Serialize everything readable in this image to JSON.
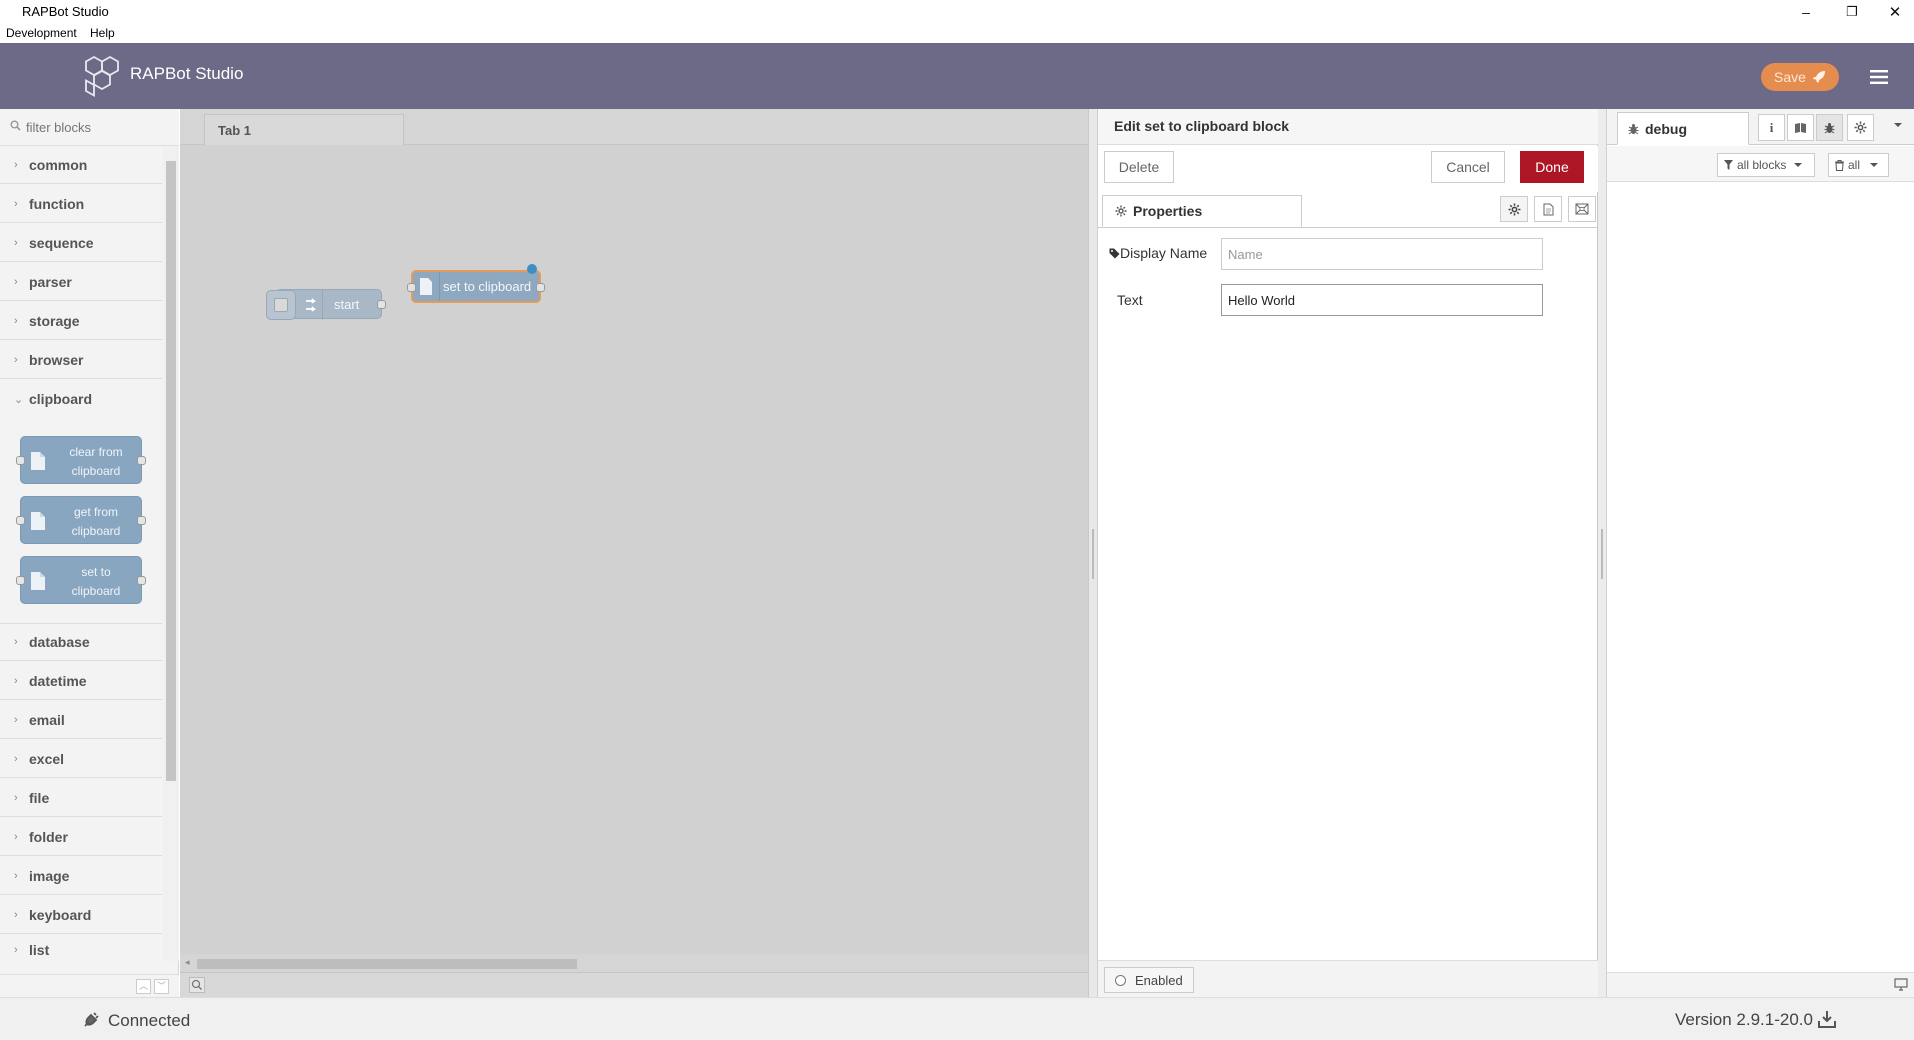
{
  "window": {
    "title": "RAPBot Studio",
    "controls": {
      "minimize": "–",
      "restore": "❐",
      "close": "✕"
    }
  },
  "menu": [
    "Development",
    "Help"
  ],
  "header": {
    "app_name": "RAPBot Studio",
    "save_label": "Save",
    "colors": {
      "header_bg": "#6d6a87",
      "save_bg": "#e58c4f"
    }
  },
  "palette": {
    "filter_placeholder": "filter blocks",
    "categories_top": [
      "common",
      "function",
      "sequence",
      "parser",
      "storage",
      "browser"
    ],
    "expanded_category": "clipboard",
    "clipboard_nodes": [
      {
        "line1": "clear from",
        "line2": "clipboard"
      },
      {
        "line1": "get from",
        "line2": "clipboard"
      },
      {
        "line1": "set to",
        "line2": "clipboard"
      }
    ],
    "categories_bottom": [
      "database",
      "datetime",
      "email",
      "excel",
      "file",
      "folder",
      "image",
      "keyboard",
      "list"
    ]
  },
  "workspace": {
    "tab_label": "Tab 1",
    "nodes": [
      {
        "label": "start",
        "icon": "arrows-icon"
      },
      {
        "label": "set to clipboard",
        "icon": "document-icon"
      }
    ]
  },
  "editor": {
    "title": "Edit set to clipboard block",
    "delete_label": "Delete",
    "cancel_label": "Cancel",
    "done_label": "Done",
    "properties_tab": "Properties",
    "fields": {
      "display_name_label": "Display Name",
      "display_name_placeholder": "Name",
      "display_name_value": "",
      "text_label": "Text",
      "text_value": "Hello World"
    },
    "enabled_label": "Enabled",
    "colors": {
      "done_bg": "#ad1625"
    }
  },
  "debug": {
    "tab_label": "debug",
    "filter_label": "all blocks",
    "clear_label": "all"
  },
  "status": {
    "connection": "Connected",
    "version": "Version 2.9.1-20.0"
  }
}
